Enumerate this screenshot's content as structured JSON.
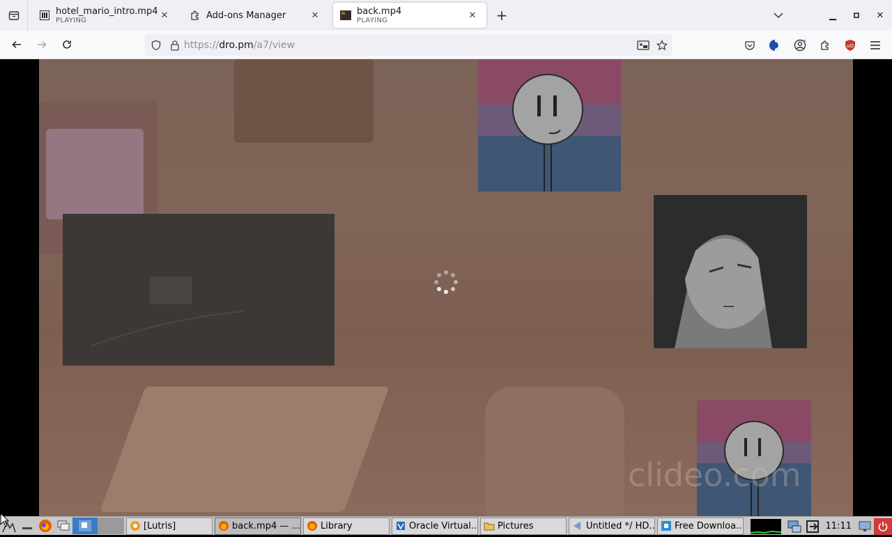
{
  "browser": {
    "tabs": [
      {
        "title": "hotel_mario_intro.mp4",
        "status": "PLAYING",
        "active": false
      },
      {
        "title": "Add-ons Manager",
        "status": "",
        "active": false
      },
      {
        "title": "back.mp4",
        "status": "PLAYING",
        "active": true
      }
    ],
    "url": {
      "scheme": "https://",
      "host": "dro.pm",
      "path": "/a7/view"
    }
  },
  "video": {
    "watermark": "clideo.com"
  },
  "taskbar": {
    "tasks": [
      {
        "label": "[Lutris]",
        "icon": "lutris-icon"
      },
      {
        "label": "back.mp4 — ...",
        "icon": "firefox-icon",
        "active": true
      },
      {
        "label": "Library",
        "icon": "firefox-icon"
      },
      {
        "label": "Oracle Virtual...",
        "icon": "virtualbox-icon"
      },
      {
        "label": "Pictures",
        "icon": "folder-icon"
      },
      {
        "label": "Untitled */ HD...",
        "icon": "editor-icon"
      },
      {
        "label": "Free Downloa...",
        "icon": "download-icon"
      }
    ],
    "clock": "11:11"
  },
  "colors": {
    "tab_bar": "#f0f0f4",
    "accent_shield": "#c0392b"
  }
}
